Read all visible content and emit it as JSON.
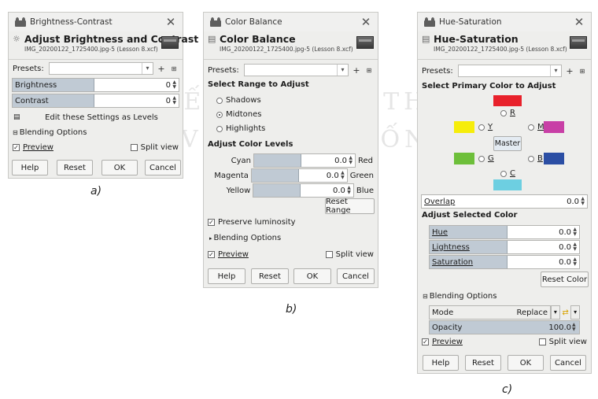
{
  "watermark": {
    "line1": "KẾT NỐI TRI THỨC",
    "line2": "VỚI CUỘC SỐNG"
  },
  "dialog_a": {
    "window_title": "Brightness-Contrast",
    "header_title": "Adjust Brightness and Contrast",
    "header_sub": "IMG_20200122_1725400.jpg-5 (Lesson 8.xcf)",
    "presets_label": "Presets:",
    "brightness_label": "Brightness",
    "brightness_value": "0",
    "contrast_label": "Contrast",
    "contrast_value": "0",
    "edit_levels_label": "Edit these Settings as Levels",
    "blending_label": "Blending Options",
    "preview_label": "Preview",
    "split_view_label": "Split view",
    "help": "Help",
    "reset": "Reset",
    "ok": "OK",
    "cancel": "Cancel",
    "caption": "a)"
  },
  "dialog_b": {
    "window_title": "Color Balance",
    "header_title": "Color Balance",
    "header_sub": "IMG_20200122_1725400.jpg-5 (Lesson 8.xcf)",
    "presets_label": "Presets:",
    "select_range_label": "Select Range to Adjust",
    "ranges": [
      "Shadows",
      "Midtones",
      "Highlights"
    ],
    "selected_range": "Midtones",
    "adjust_levels_label": "Adjust Color Levels",
    "levels": [
      {
        "left": "Cyan",
        "value": "0.0",
        "right": "Red"
      },
      {
        "left": "Magenta",
        "value": "0.0",
        "right": "Green"
      },
      {
        "left": "Yellow",
        "value": "0.0",
        "right": "Blue"
      }
    ],
    "reset_range": "Reset Range",
    "preserve_label": "Preserve luminosity",
    "blending_label": "Blending Options",
    "preview_label": "Preview",
    "split_view_label": "Split view",
    "help": "Help",
    "reset": "Reset",
    "ok": "OK",
    "cancel": "Cancel",
    "caption": "b)"
  },
  "dialog_c": {
    "window_title": "Hue-Saturation",
    "header_title": "Hue-Saturation",
    "header_sub": "IMG_20200122_1725400.jpg-5 (Lesson 8.xcf)",
    "presets_label": "Presets:",
    "primary_label": "Select Primary Color to Adjust",
    "colors": {
      "R": "#e8212b",
      "Y": "#f6ed0a",
      "M": "#c83fa6",
      "G": "#6dbf3a",
      "B": "#2b4ea4",
      "C": "#6dcfe1"
    },
    "radio_r": "R",
    "radio_y": "Y",
    "radio_m": "M",
    "radio_g": "G",
    "radio_b": "B",
    "radio_c": "C",
    "master": "Master",
    "overlap_label": "Overlap",
    "overlap_value": "0.0",
    "adjust_selected_label": "Adjust Selected Color",
    "hue_label": "Hue",
    "hue_value": "0.0",
    "lightness_label": "Lightness",
    "lightness_value": "0.0",
    "saturation_label": "Saturation",
    "saturation_value": "0.0",
    "reset_color": "Reset Color",
    "blending_label": "Blending Options",
    "mode_label": "Mode",
    "mode_value": "Replace",
    "opacity_label": "Opacity",
    "opacity_value": "100.0",
    "preview_label": "Preview",
    "split_view_label": "Split view",
    "help": "Help",
    "reset": "Reset",
    "ok": "OK",
    "cancel": "Cancel",
    "caption": "c)"
  }
}
